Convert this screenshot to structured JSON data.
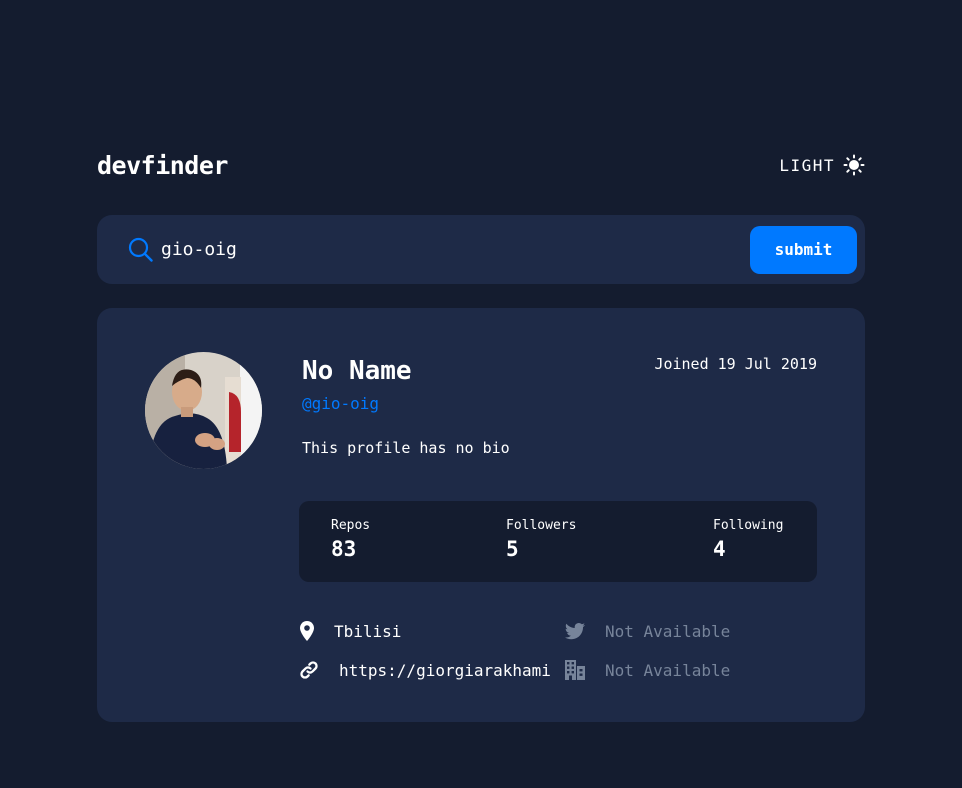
{
  "header": {
    "logo": "devfinder",
    "theme_label": "LIGHT",
    "theme_icon": "sun-icon"
  },
  "search": {
    "value": "gio-oig",
    "placeholder": "",
    "submit_label": "submit",
    "icon": "search-icon"
  },
  "profile": {
    "name": "No Name",
    "login": "@gio-oig",
    "joined": "Joined 19 Jul 2019",
    "bio": "This profile has no bio",
    "stats": {
      "repos_label": "Repos",
      "repos": "83",
      "followers_label": "Followers",
      "followers": "5",
      "following_label": "Following",
      "following": "4"
    },
    "links": {
      "location": "Tbilisi",
      "blog": "https://giorgiarakhami",
      "twitter": "Not Available",
      "company": "Not Available"
    }
  },
  "colors": {
    "background": "#141c2f",
    "card": "#1e2a47",
    "accent": "#0079ff",
    "muted": "#77849a",
    "text": "#ffffff"
  }
}
